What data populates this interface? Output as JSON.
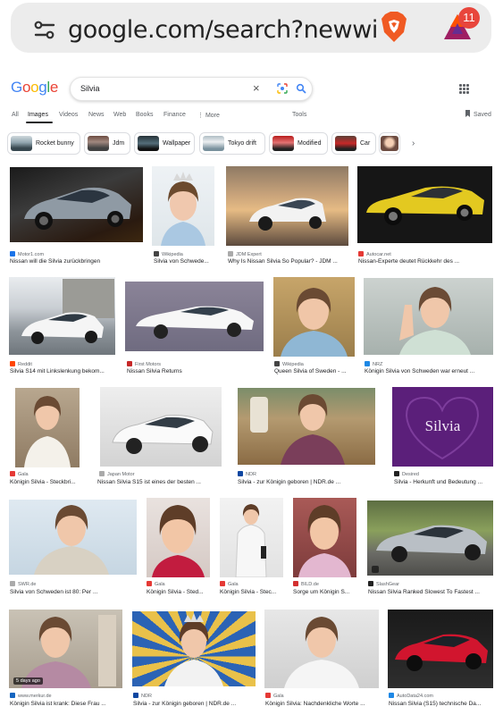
{
  "browser": {
    "url": "google.com/search?newwindow",
    "notification_count": "11"
  },
  "google": {
    "logo": [
      "G",
      "o",
      "o",
      "g",
      "l",
      "e"
    ],
    "logo_colors": [
      "#4285F4",
      "#EA4335",
      "#FBBC05",
      "#4285F4",
      "#34A853",
      "#EA4335"
    ],
    "query": "Silvia"
  },
  "tabs": [
    "All",
    "Images",
    "Videos",
    "News",
    "Web",
    "Books",
    "Finance",
    "⋮ More"
  ],
  "tools_label": "Tools",
  "saved_label": "Saved",
  "chips": [
    "Rocket bunny",
    "Jdm",
    "Wallpaper",
    "Tokyo drift",
    "Modified",
    "Car"
  ],
  "results": [
    {
      "source": "Motor1.com",
      "caption": "Nissan will die Silvia zurückbringen",
      "src_color": "#1a73e8"
    },
    {
      "source": "Wikipedia",
      "caption": "Silvia von Schwede...",
      "src_color": "#444"
    },
    {
      "source": "JDM Expert",
      "caption": "Why Is Nissan Silvia So Popular? - JDM ...",
      "src_color": "#aaa"
    },
    {
      "source": "Autocar.net",
      "caption": "Nissan-Experte deutet Rückkehr des ...",
      "src_color": "#e53935"
    },
    {
      "source": "Reddit",
      "caption": "Silvia S14 mit Linkslenkung bekom...",
      "src_color": "#ff4500"
    },
    {
      "source": "First Motors",
      "caption": "Nissan Silvia Returns",
      "src_color": "#c62828"
    },
    {
      "source": "Wikipedia",
      "caption": "Queen Silvia of Sweden - ...",
      "src_color": "#444"
    },
    {
      "source": "NRZ",
      "caption": "Königin Silvia von Schweden war erneut ...",
      "src_color": "#1e88e5"
    },
    {
      "source": "Gala",
      "caption": "Königin Silvia - Steckbri...",
      "src_color": "#e53935"
    },
    {
      "source": "Japan Motor",
      "caption": "Nissan Silvia S15 ist eines der besten ...",
      "src_color": "#aaa"
    },
    {
      "source": "NDR",
      "caption": "Silvia - zur Königin geboren | NDR.de ...",
      "src_color": "#0d47a1"
    },
    {
      "source": "Desired",
      "caption": "Silvia - Herkunft und Bedeutung ...",
      "src_color": "#222"
    },
    {
      "source": "SWR.de",
      "caption": "Silvia von Schweden ist 80: Per ...",
      "src_color": "#aaa"
    },
    {
      "source": "Gala",
      "caption": "Königin Silvia - Sted...",
      "src_color": "#e53935"
    },
    {
      "source": "Gala",
      "caption": "Königin Silvia - Stec...",
      "src_color": "#e53935"
    },
    {
      "source": "BILD.de",
      "caption": "Sorge um Königin S...",
      "src_color": "#d32f2f"
    },
    {
      "source": "SlashGear",
      "caption": "Nissan Silvia Ranked Slowest To Fastest ...",
      "src_color": "#222"
    },
    {
      "source": "www.merkur.de",
      "caption": "Königin Silvia ist krank: Diese Frau ...",
      "src_color": "#1565c0"
    },
    {
      "source": "NDR",
      "caption": "Silvia - zur Königin geboren | NDR.de ...",
      "src_color": "#0d47a1"
    },
    {
      "source": "Gala",
      "caption": "Königin Silvia: Nachdenkliche Worte ...",
      "src_color": "#e53935"
    },
    {
      "source": "AutoData24.com",
      "caption": "Nissan Silvia (S15) technische Da...",
      "src_color": "#1e88e5"
    }
  ],
  "silvia_card_text": "Silvia",
  "time_stamp": "5 days ago"
}
